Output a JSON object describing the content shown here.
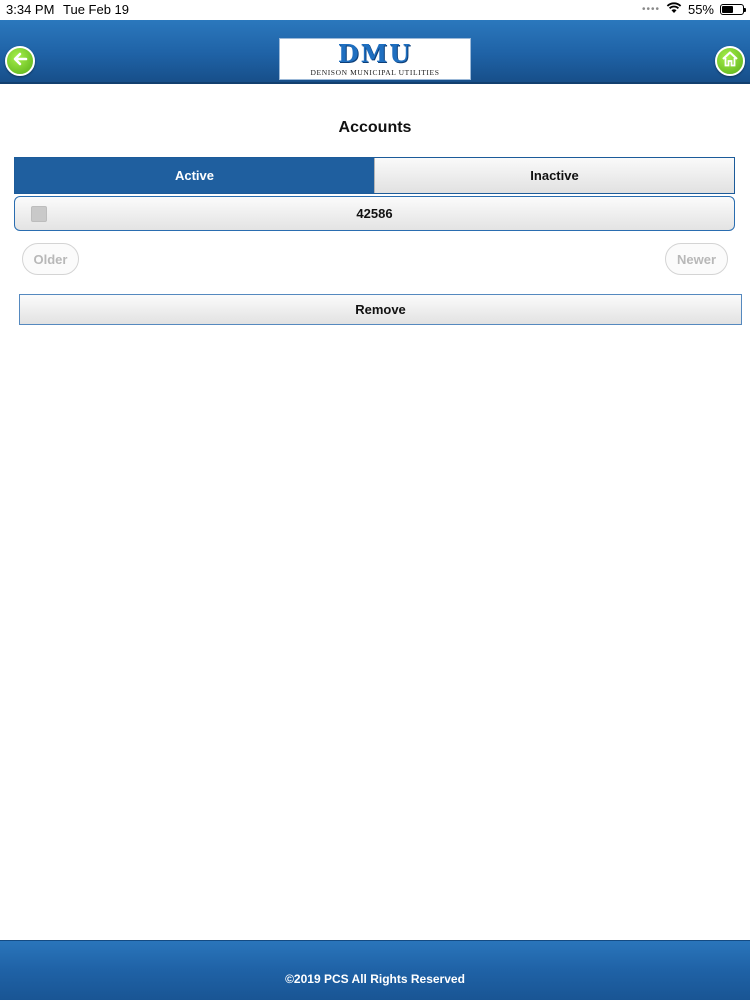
{
  "status_bar": {
    "time": "3:34 PM",
    "date": "Tue Feb 19",
    "dots": "••••",
    "battery_percent": "55%",
    "battery_level": 0.55,
    "wifi_icon": "wifi-icon",
    "battery_icon": "battery-icon"
  },
  "header": {
    "back_icon": "back-arrow-icon",
    "home_icon": "home-icon",
    "logo_mark": "DMU",
    "logo_subtitle": "DENISON MUNICIPAL UTILITIES",
    "accent_color": "#1f62a6",
    "button_color": "#6cc521"
  },
  "main": {
    "title": "Accounts",
    "tabs": [
      {
        "label": "Active",
        "selected": true
      },
      {
        "label": "Inactive",
        "selected": false
      }
    ],
    "accounts": [
      {
        "number": "42586",
        "checked": false
      }
    ],
    "pagination": {
      "older_label": "Older",
      "newer_label": "Newer"
    },
    "remove_label": "Remove"
  },
  "footer": {
    "text": "©2019 PCS All Rights Reserved"
  }
}
